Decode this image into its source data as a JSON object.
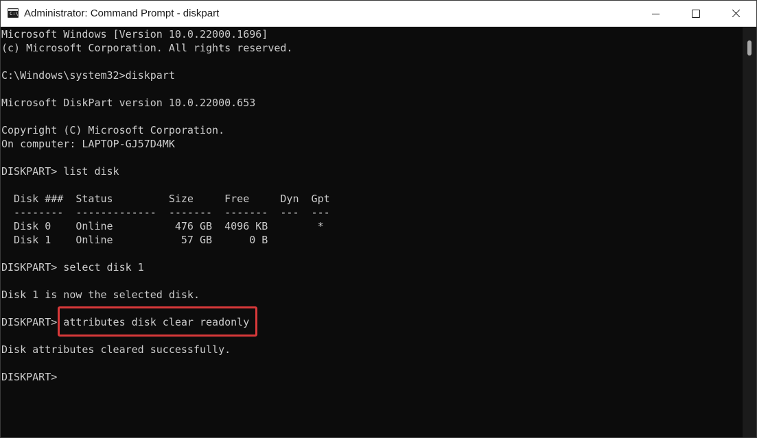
{
  "window": {
    "title": "Administrator: Command Prompt - diskpart",
    "icon": "cmd-icon",
    "icon_glyph": "C:\\"
  },
  "console": {
    "lines": [
      "Microsoft Windows [Version 10.0.22000.1696]",
      "(c) Microsoft Corporation. All rights reserved.",
      "",
      "C:\\Windows\\system32>diskpart",
      "",
      "Microsoft DiskPart version 10.0.22000.653",
      "",
      "Copyright (C) Microsoft Corporation.",
      "On computer: LAPTOP-GJ57D4MK",
      "",
      "DISKPART> list disk",
      "",
      "  Disk ###  Status         Size     Free     Dyn  Gpt",
      "  --------  -------------  -------  -------  ---  ---",
      "  Disk 0    Online          476 GB  4096 KB        *",
      "  Disk 1    Online           57 GB      0 B",
      "",
      "DISKPART> select disk 1",
      "",
      "Disk 1 is now the selected disk.",
      "",
      "DISKPART> attributes disk clear readonly",
      "",
      "Disk attributes cleared successfully.",
      "",
      "DISKPART> "
    ]
  },
  "colors": {
    "console_bg": "#0c0c0c",
    "console_text": "#cccccc",
    "highlight": "#d9393a",
    "titlebar_bg": "#ffffff"
  }
}
